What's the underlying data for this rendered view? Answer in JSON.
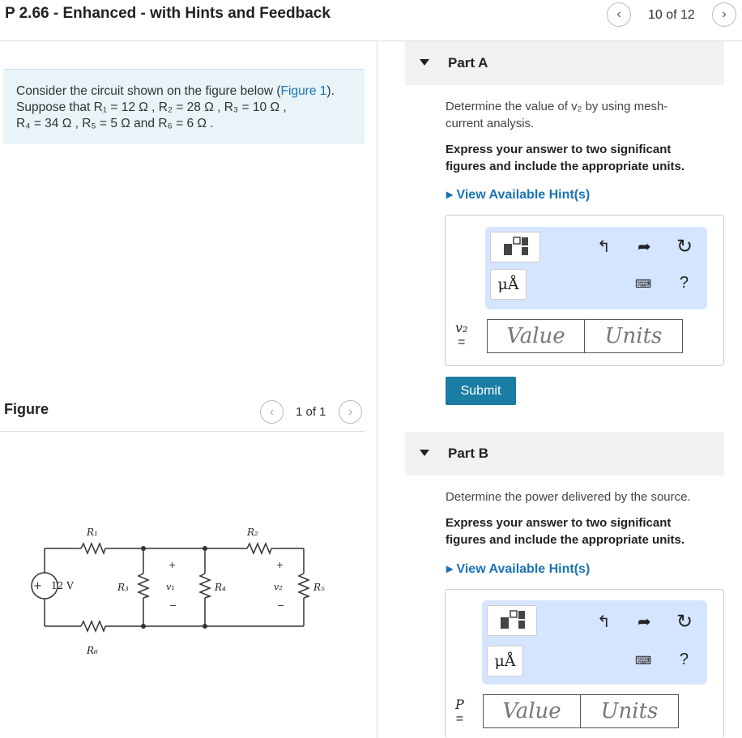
{
  "header": {
    "title": "P 2.66 - Enhanced - with Hints and Feedback",
    "pager": "10 of 12",
    "prev_icon": "chevron-left-icon",
    "next_icon": "chevron-right-icon"
  },
  "intro": {
    "line1_prefix": "Consider the circuit shown on the figure below (",
    "figure_link": "Figure 1",
    "line1_suffix": ").",
    "line2": "Suppose that R₁ = 12 Ω , R₂ = 28 Ω , R₃ = 10 Ω ,",
    "line3": "R₄ = 34 Ω , R₅ = 5 Ω and R₆ = 6 Ω ."
  },
  "figure": {
    "label": "Figure",
    "pager": "1 of 1",
    "source_label": "12 V",
    "labels": {
      "R1": "R₁",
      "R2": "R₂",
      "R3": "R₃",
      "R4": "R₄",
      "R5": "R₅",
      "R6": "R₆",
      "v1": "v₁",
      "v2": "v₂",
      "plus": "+",
      "minus": "−"
    }
  },
  "partA": {
    "label": "Part A",
    "question": "Determine the value of v₂ by using mesh-current analysis.",
    "question_line1": "Determine the value of v₂ by using mesh-",
    "question_line2": "current analysis.",
    "instruction_line1": "Express your answer to two significant",
    "instruction_line2": "figures and include the appropriate units.",
    "hint": "▸ View Available Hint(s)",
    "var_label": "v₂",
    "equals": "=",
    "value_placeholder": "Value",
    "units_placeholder": "Units",
    "submit": "Submit",
    "units_button": "μÅ",
    "help": "?"
  },
  "partB": {
    "label": "Part B",
    "question": "Determine the power delivered by the source.",
    "instruction_line1": "Express your answer to two significant",
    "instruction_line2": "figures and include the appropriate units.",
    "hint": "▸ View Available Hint(s)",
    "var_label": "P",
    "equals": "=",
    "value_placeholder": "Value",
    "units_placeholder": "Units",
    "units_button": "μÅ",
    "help": "?"
  },
  "colors": {
    "accent": "#1a73b5",
    "submit_bg": "#1a7da3",
    "toolbar_bg": "#d5e5ff",
    "intro_bg": "#e8f4f7"
  }
}
